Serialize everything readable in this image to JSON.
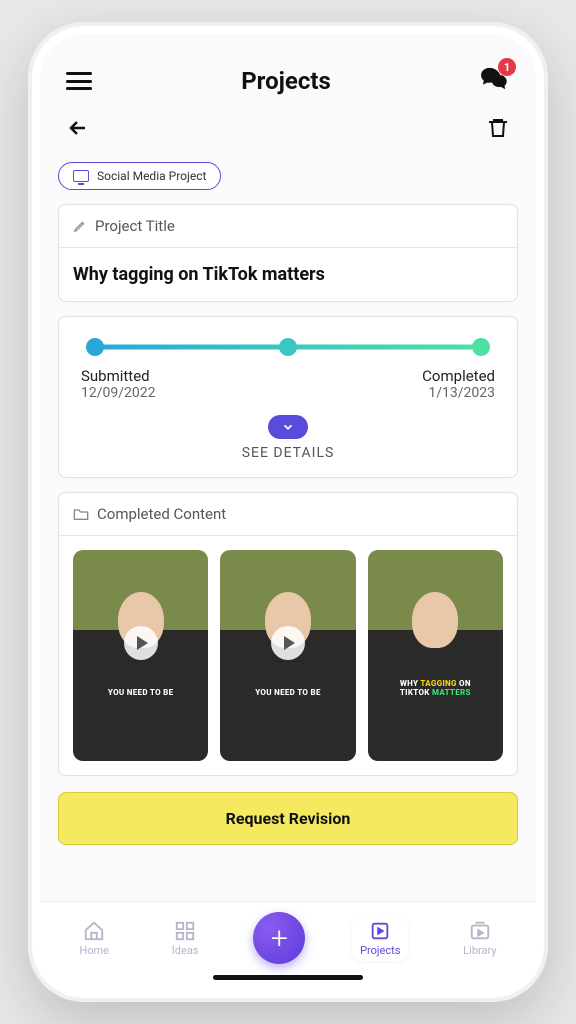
{
  "header": {
    "title": "Projects",
    "notification_count": "1"
  },
  "chip": {
    "label": "Social Media Project"
  },
  "project": {
    "header": "Project Title",
    "value": "Why tagging on TikTok matters"
  },
  "progress": {
    "left_label": "Submitted",
    "left_date": "12/09/2022",
    "right_label": "Completed",
    "right_date": "1/13/2023",
    "see_details": "SEE DETAILS"
  },
  "completed": {
    "header": "Completed Content",
    "items": [
      {
        "caption_plain": "YOU NEED TO BE",
        "has_play": true
      },
      {
        "caption_plain": "YOU NEED TO BE",
        "has_play": true
      },
      {
        "line1_a": "WHY ",
        "line1_b": "TAGGING",
        "line1_c": " ON",
        "line2_a": "TIKTOK ",
        "line2_b": "MATTERS",
        "has_play": false
      }
    ]
  },
  "actions": {
    "revision": "Request Revision"
  },
  "nav": {
    "home": "Home",
    "ideas": "Ideas",
    "projects": "Projects",
    "library": "Library"
  }
}
